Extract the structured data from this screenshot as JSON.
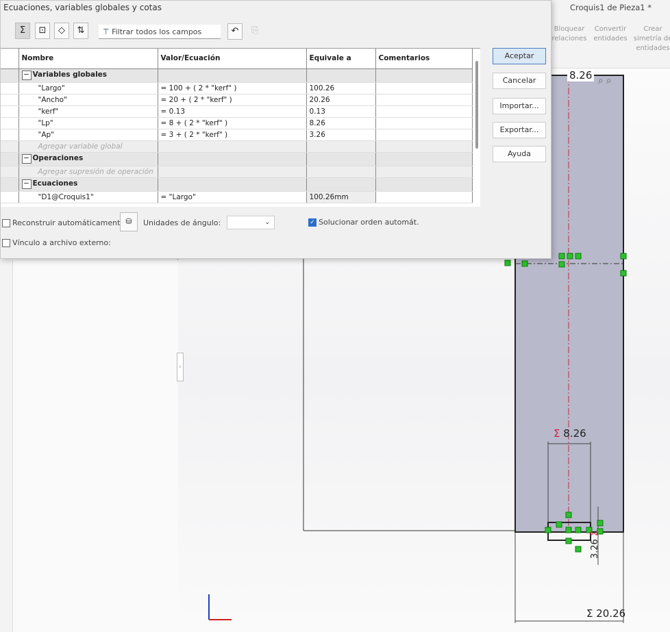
{
  "dialog": {
    "title": "Ecuaciones, variables globales y cotas",
    "filter_placeholder": "Filtrar todos los campos",
    "columns": [
      "Nombre",
      "Valor/Ecuación",
      "Equivale a",
      "Comentarios"
    ],
    "groups": [
      {
        "label": "Variables globales",
        "rows": [
          {
            "name": "\"Largo\"",
            "value": "= 100 + ( 2 * \"kerf\" )",
            "result": "100.26"
          },
          {
            "name": "\"Ancho\"",
            "value": "= 20 + ( 2 * \"kerf\" )",
            "result": "20.26"
          },
          {
            "name": "\"kerf\"",
            "value": "= 0.13",
            "result": "0.13"
          },
          {
            "name": "\"Lp\"",
            "value": "= 8 + ( 2 * \"kerf\" )",
            "result": "8.26"
          },
          {
            "name": "\"Ap\"",
            "value": "= 3 + ( 2 * \"kerf\" )",
            "result": "3.26"
          }
        ],
        "add": "Agregar variable global"
      },
      {
        "label": "Operaciones",
        "rows": [],
        "add": "Agregar supresión de operación"
      },
      {
        "label": "Ecuaciones",
        "rows": [
          {
            "name": "\"D1@Croquis1\"",
            "value": "= \"Largo\"",
            "result": "100.26mm"
          }
        ]
      }
    ],
    "buttons": {
      "accept": "Aceptar",
      "cancel": "Cancelar",
      "import": "Importar...",
      "export": "Exportar...",
      "help": "Ayuda"
    },
    "auto_rebuild": {
      "label": "Reconstruir automáticamente",
      "checked": false
    },
    "angle_units_label": "Unidades de ángulo:",
    "solve_order": {
      "label": "Solucionar orden automát.",
      "checked": true
    },
    "link_file": {
      "label": "Vínculo a archivo externo:",
      "checked": false
    }
  },
  "window": {
    "title": "Croquis1 de Pieza1 *",
    "toolbar": [
      "Bloquear\nrelaciones",
      "Convertir\nentidades",
      "Crear\nsimetría de\nentidades"
    ]
  },
  "sketch": {
    "dim_top": "8.26",
    "dim_mid": "8.26",
    "dim_small": "3.26",
    "dim_width": "20.26",
    "sigma": "Σ",
    "accent": "#2a6fca"
  }
}
